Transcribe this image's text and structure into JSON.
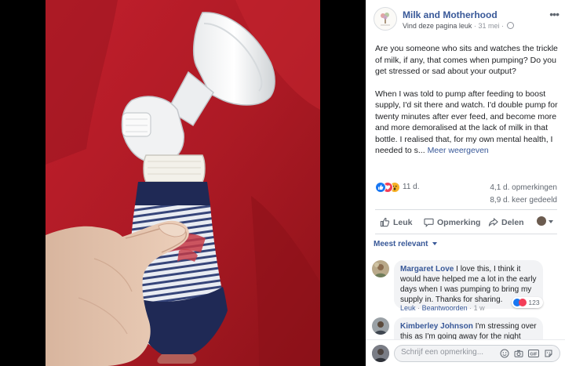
{
  "page": {
    "name": "Milk and Motherhood",
    "like_link": "Vind deze pagina leuk",
    "separator": "·",
    "date": "31 mei",
    "separator2": "·"
  },
  "post": {
    "paragraph1": "Are you someone who sits and watches the trickle of milk, if any, that comes when pumping? Do you get stressed or sad about your output?",
    "paragraph2": "When I was told to pump after feeding to boost supply, I'd sit there and watch. I'd double pump for twenty minutes after ever feed, and become more and more demoralised at the lack of milk in that bottle. I realised that, for my own mental health, I needed to s...",
    "see_more": "Meer weergeven"
  },
  "stats": {
    "reaction_count": "11 d.",
    "comments": "4,1 d. opmerkingen",
    "shares": "8,9 d. keer gedeeld"
  },
  "actions": {
    "like": "Leuk",
    "comment": "Opmerking",
    "share": "Delen"
  },
  "sort_label": "Meest relevant",
  "comments": [
    {
      "author": "Margaret Love",
      "text": "I love this, I think it would have helped me a lot in the early days when I was pumping to bring my supply in. Thanks for sharing.",
      "like": "Leuk",
      "reply": "Beantwoorden",
      "sep": "·",
      "time": "1 w",
      "reactions": "123"
    },
    {
      "author": "Kimberley Johnson",
      "text": "I'm stressing over this as I'm going away for the night next"
    }
  ],
  "composer": {
    "placeholder": "Schrijf een opmerking..."
  },
  "colors": {
    "link": "#385898",
    "like_blue": "#1877f2",
    "love_red": "#f33e58",
    "wow_yellow": "#f7b125",
    "sofa_red": "#b21c26"
  },
  "icons": [
    "menu-dots-icon",
    "globe-icon",
    "like-icon",
    "love-icon",
    "wow-icon",
    "thumbs-up-icon",
    "comment-icon",
    "share-icon",
    "chevron-down-icon",
    "emoji-icon",
    "camera-icon",
    "gif-icon",
    "sticker-icon"
  ]
}
